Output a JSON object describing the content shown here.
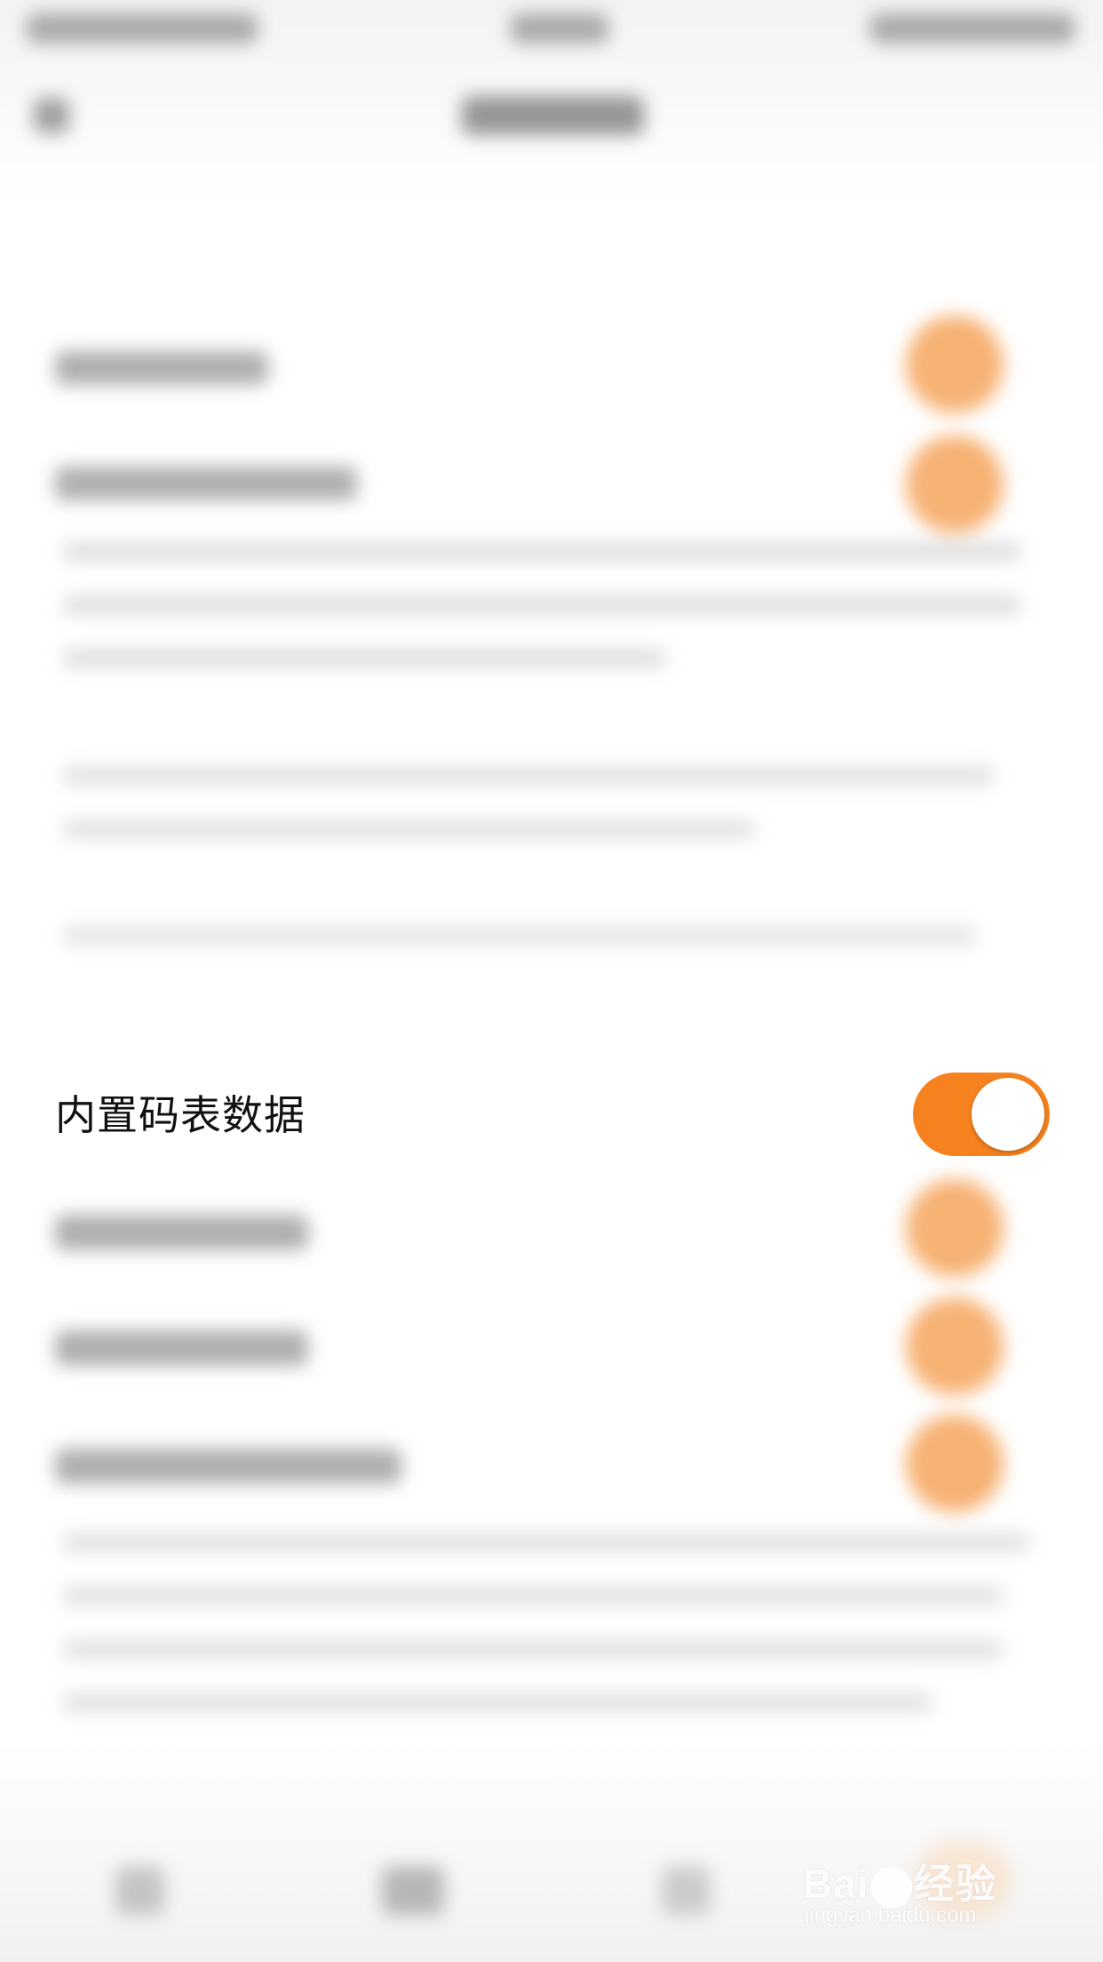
{
  "settings": {
    "focused_item": {
      "label": "内置码表数据",
      "toggle_on": true,
      "accent_color": "#f5821f"
    }
  },
  "watermark": {
    "brand_before": "Bai",
    "brand_after": "经验",
    "url": "jingyan.baidu.com"
  }
}
